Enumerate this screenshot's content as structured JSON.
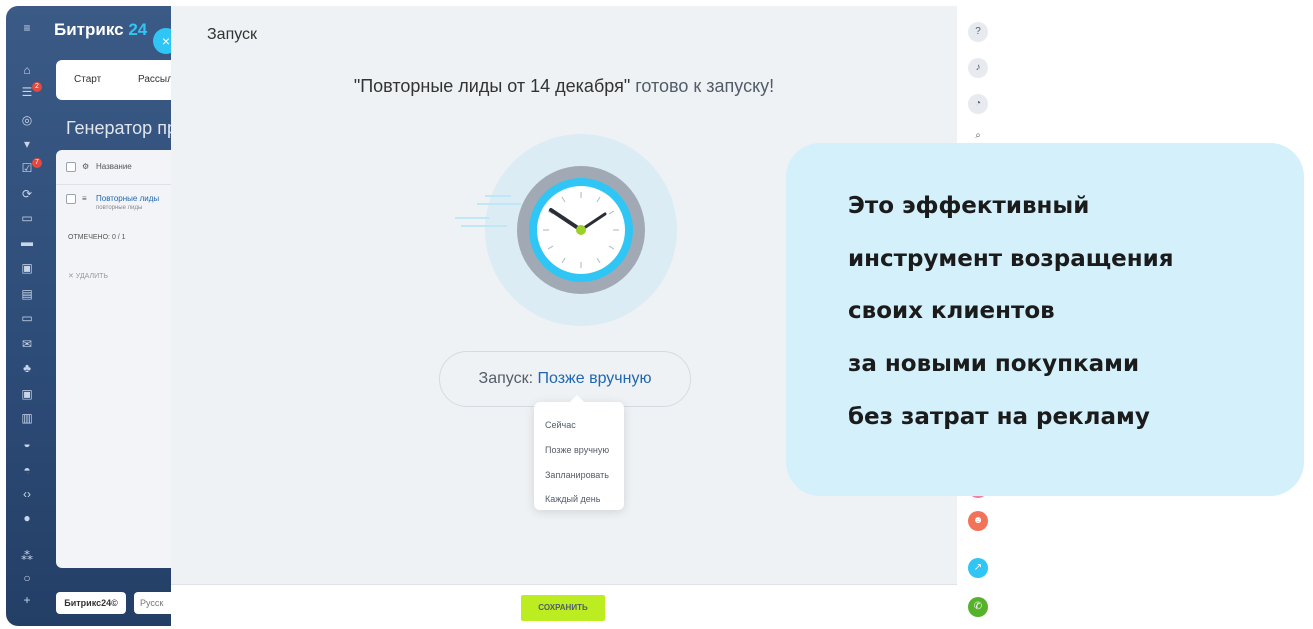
{
  "app": {
    "logo_text": "Битрикс",
    "logo_number": "24",
    "close_label": "×",
    "tabs": [
      "Старт",
      "Рассыл"
    ],
    "page_title": "Генератор пр",
    "table": {
      "header_label": "Название",
      "row_title": "Повторные лиды",
      "row_subtitle": "повторные лиды",
      "selected_label": "ОТМЕЧЕНО: 0 / 1",
      "delete_label": "✕ УДАЛИТЬ"
    },
    "footer_logo": "Битрикс24©",
    "footer_lang": "Русск"
  },
  "panel": {
    "title": "Запуск",
    "headline_name": "\"Повторные лиды от 14 декабря\"",
    "headline_rest": " готово к запуску!",
    "launch_label": "Запуск: ",
    "launch_value": "Позже вручную",
    "options": [
      "Сейчас",
      "Позже вручную",
      "Запланировать",
      "Каждый день"
    ],
    "save_label": "СОХРАНИТЬ"
  },
  "right_rail_icons": [
    "help-icon",
    "bell-icon",
    "clock-icon",
    "search-icon",
    "group-icon",
    "share-icon",
    "phone-icon"
  ],
  "callout": {
    "lines": [
      "Это эффективный",
      "инструмент возращения",
      "своих клиентов",
      "за новыми покупками",
      "без затрат на рекламу"
    ]
  },
  "colors": {
    "accent_blue": "#2fc6f6",
    "link_blue": "#2067b0",
    "save_green": "#bbed21",
    "callout_bg": "#d3f0fb"
  }
}
